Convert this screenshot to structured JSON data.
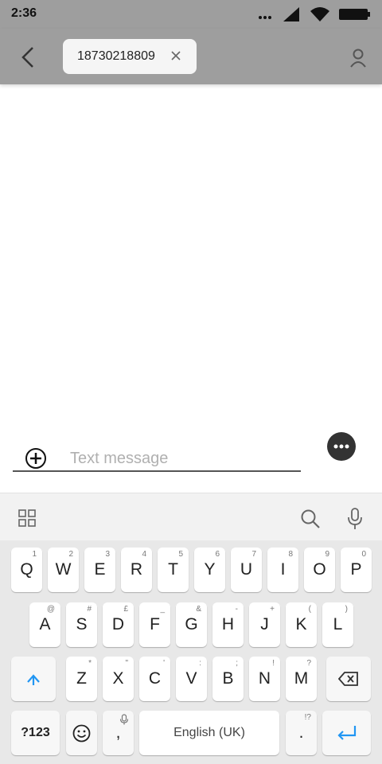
{
  "status_bar": {
    "time": "2:36"
  },
  "header": {
    "recipient": "18730218809"
  },
  "compose": {
    "placeholder": "Text message"
  },
  "keyboard": {
    "rows": [
      [
        {
          "label": "Q",
          "hint": "1"
        },
        {
          "label": "W",
          "hint": "2"
        },
        {
          "label": "E",
          "hint": "3"
        },
        {
          "label": "R",
          "hint": "4"
        },
        {
          "label": "T",
          "hint": "5"
        },
        {
          "label": "Y",
          "hint": "6"
        },
        {
          "label": "U",
          "hint": "7"
        },
        {
          "label": "I",
          "hint": "8"
        },
        {
          "label": "O",
          "hint": "9"
        },
        {
          "label": "P",
          "hint": "0"
        }
      ],
      [
        {
          "label": "A",
          "hint": "@"
        },
        {
          "label": "S",
          "hint": "#"
        },
        {
          "label": "D",
          "hint": "£"
        },
        {
          "label": "F",
          "hint": "_"
        },
        {
          "label": "G",
          "hint": "&"
        },
        {
          "label": "H",
          "hint": "-"
        },
        {
          "label": "J",
          "hint": "+"
        },
        {
          "label": "K",
          "hint": "("
        },
        {
          "label": "L",
          "hint": ")"
        }
      ],
      [
        {
          "label": "Z",
          "hint": "*"
        },
        {
          "label": "X",
          "hint": "\""
        },
        {
          "label": "C",
          "hint": "'"
        },
        {
          "label": "V",
          "hint": ":"
        },
        {
          "label": "B",
          "hint": ";"
        },
        {
          "label": "N",
          "hint": "!"
        },
        {
          "label": "M",
          "hint": "?"
        }
      ]
    ],
    "symbols_label": "?123",
    "comma_label": ",",
    "space_label": "English (UK)",
    "period_label": ".",
    "period_hint": "!?"
  },
  "colors": {
    "header_bg": "#9e9e9e",
    "enter_accent": "#2196f3",
    "keyboard_bg": "#e8e8e8"
  }
}
